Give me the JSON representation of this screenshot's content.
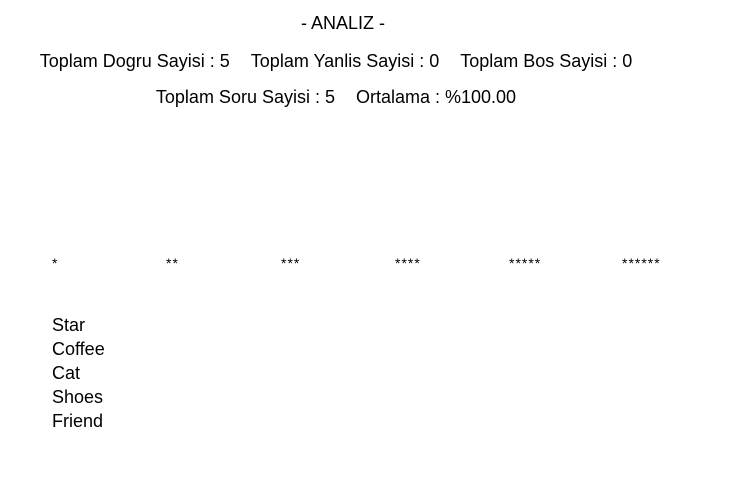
{
  "analysis": {
    "title": "- ANALIZ -",
    "stats_row1": [
      "Toplam Dogru Sayisi : 5",
      "Toplam Yanlis Sayisi : 0",
      "Toplam Bos Sayisi : 0"
    ],
    "stats_row2": [
      "Toplam Soru Sayisi : 5",
      "Ortalama : %100.00"
    ]
  },
  "stars": [
    "*",
    "**",
    "***",
    "****",
    "*****",
    "******"
  ],
  "words": [
    "Star",
    "Coffee",
    "Cat",
    "Shoes",
    "Friend"
  ]
}
